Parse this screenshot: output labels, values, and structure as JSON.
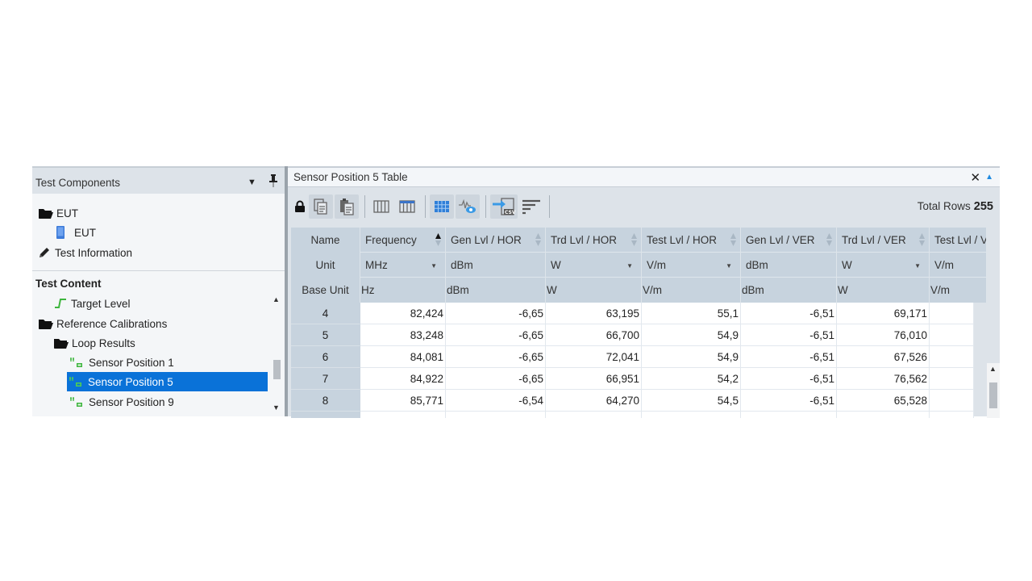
{
  "left_panel": {
    "title": "Test Components",
    "components": [
      {
        "label": "EUT",
        "icon": "folder-open-icon",
        "level": 0
      },
      {
        "label": "EUT",
        "icon": "device-icon",
        "level": 1
      },
      {
        "label": "Test Information",
        "icon": "pencil-icon",
        "level": 0
      }
    ],
    "content_title": "Test Content",
    "content_items": [
      {
        "label": "Target Level",
        "icon": "step-signal-icon",
        "level": 1
      },
      {
        "label": "Reference Calibrations",
        "icon": "folder-open-icon",
        "level": 0
      },
      {
        "label": "Loop Results",
        "icon": "folder-open-icon",
        "level": 1
      },
      {
        "label": "Sensor Position 1",
        "icon": "sensor-icon",
        "level": 2
      },
      {
        "label": "Sensor Position 5",
        "icon": "sensor-icon",
        "level": 2,
        "selected": true
      },
      {
        "label": "Sensor Position 9",
        "icon": "sensor-icon",
        "level": 2
      }
    ]
  },
  "right_panel": {
    "title": "Sensor Position 5 Table",
    "total_rows_label": "Total Rows",
    "total_rows": "255",
    "toolbar": [
      "lock",
      "copy",
      "paste",
      "columns",
      "column-header",
      "grid",
      "signal-view",
      "export-csv",
      "sort-lines"
    ]
  },
  "grid": {
    "row_header_labels": [
      "Name",
      "Unit",
      "Base Unit"
    ],
    "columns": [
      {
        "name": "Frequency",
        "unit": "MHz",
        "unit_dropdown": true,
        "base_unit": "Hz",
        "sort": "asc"
      },
      {
        "name": "Gen Lvl / HOR",
        "unit": "dBm",
        "unit_dropdown": false,
        "base_unit": "dBm",
        "sort": "none"
      },
      {
        "name": "Trd Lvl / HOR",
        "unit": "W",
        "unit_dropdown": true,
        "base_unit": "W",
        "sort": "none"
      },
      {
        "name": "Test Lvl / HOR",
        "unit": "V/m",
        "unit_dropdown": true,
        "base_unit": "V/m",
        "sort": "none"
      },
      {
        "name": "Gen Lvl / VER",
        "unit": "dBm",
        "unit_dropdown": false,
        "base_unit": "dBm",
        "sort": "none"
      },
      {
        "name": "Trd Lvl / VER",
        "unit": "W",
        "unit_dropdown": true,
        "base_unit": "W",
        "sort": "none"
      },
      {
        "name": "Test Lvl / V",
        "unit": "V/m",
        "unit_dropdown": false,
        "base_unit": "V/m",
        "sort": "none"
      }
    ],
    "rows": [
      {
        "index": "4",
        "values": [
          "82,424",
          "-6,65",
          "63,195",
          "55,1",
          "-6,51",
          "69,171",
          ""
        ]
      },
      {
        "index": "5",
        "values": [
          "83,248",
          "-6,65",
          "66,700",
          "54,9",
          "-6,51",
          "76,010",
          ""
        ]
      },
      {
        "index": "6",
        "values": [
          "84,081",
          "-6,65",
          "72,041",
          "54,9",
          "-6,51",
          "67,526",
          ""
        ]
      },
      {
        "index": "7",
        "values": [
          "84,922",
          "-6,65",
          "66,951",
          "54,2",
          "-6,51",
          "76,562",
          ""
        ]
      },
      {
        "index": "8",
        "values": [
          "85,771",
          "-6,54",
          "64,270",
          "54,5",
          "-6,51",
          "65,528",
          ""
        ]
      }
    ]
  },
  "colors": {
    "selection": "#0a72d8",
    "header_bg": "#c7d3de",
    "panel_bg": "#dde3e9",
    "accent_blue": "#1f8ae0",
    "icon_green": "#3db53d"
  }
}
